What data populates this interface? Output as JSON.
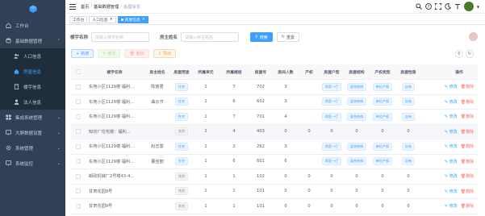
{
  "sidebar": {
    "items": [
      {
        "label": "工作台",
        "icon": "home-icon"
      },
      {
        "label": "基础数据管理",
        "icon": "database-icon",
        "expanded": true
      },
      {
        "label": "人口信息",
        "icon": "users-icon",
        "sub": true
      },
      {
        "label": "房屋信息",
        "icon": "house-icon",
        "sub": true,
        "active": true
      },
      {
        "label": "楼宇信息",
        "icon": "building-icon",
        "sub": true
      },
      {
        "label": "法人信息",
        "icon": "person-icon",
        "sub": true
      },
      {
        "label": "集成系统管理",
        "icon": "grid-icon"
      },
      {
        "label": "大屏数据设置",
        "icon": "monitor-icon"
      },
      {
        "label": "系统管理",
        "icon": "gear-icon"
      },
      {
        "label": "系统监控",
        "icon": "monitor-icon"
      }
    ]
  },
  "navbar": {
    "breadcrumb": [
      "首页",
      "基础数据管理",
      "房屋信息"
    ]
  },
  "tags": [
    {
      "label": "工作台",
      "active": false
    },
    {
      "label": "人口信息",
      "active": false
    },
    {
      "label": "房屋信息",
      "active": true
    }
  ],
  "search": {
    "building_label": "楼宇名称",
    "building_placeholder": "请输入楼宇名称",
    "owner_label": "房主姓名",
    "owner_placeholder": "请输入房主姓名",
    "search_button": "搜索",
    "reset_button": "重置"
  },
  "toolbar": {
    "add": "新增",
    "edit": "修改",
    "delete": "删除",
    "export": "导出"
  },
  "table": {
    "headers": [
      "楼宇名称",
      "房主姓名",
      "房屋用途",
      "所属单元",
      "所属楼层",
      "房屋号",
      "房间人数",
      "产权",
      "房屋户型",
      "房屋结构",
      "产权类型",
      "房屋性质",
      "操作"
    ],
    "op_edit": "修改",
    "op_delete": "删除",
    "rows": [
      {
        "building": "东苑小区1129楼 福利...",
        "owner": "陈丽君",
        "use": "住宅",
        "unit": "1",
        "floor": "7",
        "room": "702",
        "people": "3",
        "property": "",
        "layout": "两室一厅",
        "structure": "混合结构",
        "ptype": "单位产权",
        "nature": "自有"
      },
      {
        "building": "东苑小区1129楼 福利...",
        "owner": "曲云节",
        "use": "住宅",
        "unit": "1",
        "floor": "6",
        "room": "602",
        "people": "3",
        "property": "",
        "layout": "两室一厅",
        "structure": "混合结构",
        "ptype": "单位产权",
        "nature": "自有"
      },
      {
        "building": "东苑小区1129楼 福利...",
        "owner": "",
        "use": "住宅",
        "unit": "1",
        "floor": "7",
        "room": "701",
        "people": "4",
        "property": "",
        "layout": "两室一厅",
        "structure": "混合结构",
        "ptype": "单位产权",
        "nature": "自有"
      },
      {
        "building": "知坊厂住宅楼：福利...",
        "owner": "",
        "use": "其他",
        "unit": "2",
        "floor": "4",
        "room": "403",
        "people": "0",
        "property": "0",
        "layout": "0",
        "structure": "0",
        "ptype": "0",
        "nature": "0"
      },
      {
        "building": "东苑小区1129楼 福利...",
        "owner": "赵志富",
        "use": "住宅",
        "unit": "1",
        "floor": "2",
        "room": "262",
        "people": "3",
        "property": "",
        "layout": "两室一厅",
        "structure": "混合结构",
        "ptype": "单位产权",
        "nature": "自有"
      },
      {
        "building": "东苑小区1129楼 福利...",
        "owner": "董佳丽",
        "use": "住宅",
        "unit": "1",
        "floor": "6",
        "room": "601",
        "people": "6",
        "property": "",
        "layout": "两室一厅",
        "structure": "混合结构",
        "ptype": "单位产权",
        "nature": "自有"
      },
      {
        "building": "邮政机械厂2号楼43-4...",
        "owner": "",
        "use": "其他",
        "unit": "1",
        "floor": "1",
        "room": "102",
        "people": "0",
        "property": "0",
        "layout": "0",
        "structure": "0",
        "ptype": "0",
        "nature": "0"
      },
      {
        "building": "甘肃花园9号",
        "owner": "",
        "use": "其他",
        "unit": "1",
        "floor": "1",
        "room": "101",
        "people": "0",
        "property": "0",
        "layout": "0",
        "structure": "0",
        "ptype": "0",
        "nature": "0"
      },
      {
        "building": "甘肃花园9号",
        "owner": "",
        "use": "其他",
        "unit": "1",
        "floor": "1",
        "room": "101",
        "people": "0",
        "property": "0",
        "layout": "0",
        "structure": "0",
        "ptype": "0",
        "nature": "0"
      }
    ]
  }
}
